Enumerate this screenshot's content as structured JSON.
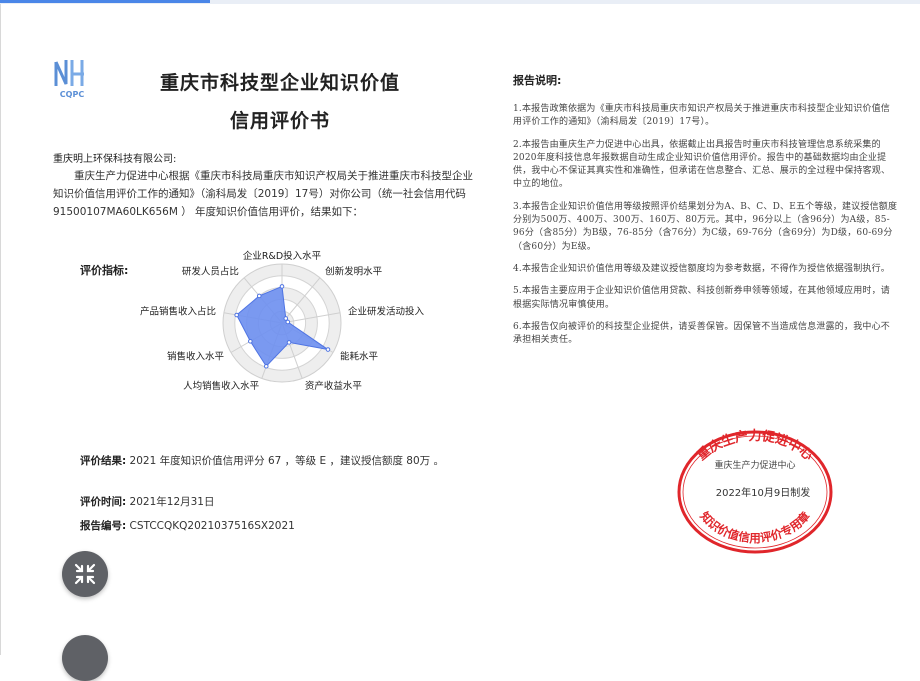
{
  "document": {
    "logo_text": "CQPC",
    "title_line1": "重庆市科技型企业知识价值",
    "title_line2": "信用评价书",
    "company": "重庆明上环保科技有限公司:",
    "intro": "重庆生产力促进中心根据《重庆市科技局重庆市知识产权局关于推进重庆市科技型企业知识价值信用评价工作的通知》（渝科局发〔2019〕17号）对你公司（统一社会信用代码 91500107MA60LK656M ） 年度知识价值信用评价，结果如下：",
    "indicators_label": "评价指标:",
    "radar": {
      "axes": [
        "企业R&D投入水平",
        "创新发明水平",
        "企业研发活动投入",
        "能耗水平",
        "资产收益水平",
        "人均销售收入水平",
        "销售收入水平",
        "产品销售收入占比",
        "研发人员占比"
      ],
      "values": [
        0.62,
        0.1,
        0.1,
        0.9,
        0.35,
        0.78,
        0.62,
        0.78,
        0.6
      ],
      "fill_color": "#6d8ff0",
      "stroke_color": "#4f74e3"
    },
    "result_label": "评价结果:",
    "result_text": "2021 年度知识价值信用评分 67 ，等级 E ，建议授信额度 80万 。",
    "time_label": "评价时间:",
    "time_value": "2021年12月31日",
    "code_label": "报告编号:",
    "code_value": "CSTCCQKQ2021037516SX2021"
  },
  "notes": {
    "title": "报告说明:",
    "items": [
      "1.本报告政策依据为《重庆市科技局重庆市知识产权局关于推进重庆市科技型企业知识价值信用评价工作的通知》（渝科局发〔2019〕17号）。",
      "2.本报告由重庆生产力促进中心出具，依据截止出具报告时重庆市科技管理信息系统采集的2020年度科技信息年报数据自动生成企业知识价值信用评价。报告中的基础数据均由企业提供，我中心不保证其真实性和准确性，但承诺在信息整合、汇总、展示的全过程中保持客观、中立的地位。",
      "3.本报告企业知识价值信用等级按照评价结果划分为A、B、C、D、E五个等级，建议授信额度分别为500万、400万、300万、160万、80万元。其中，96分以上（含96分）为A级，85-96分（含85分）为B级，76-85分（含76分）为C级，69-76分（含69分）为D级，60-69分（含60分）为E级。",
      "4.本报告企业知识价值信用等级及建议授信额度均为参考数据，不得作为授信依据强制执行。",
      "5.本报告主要应用于企业知识价值信用贷款、科技创新券申领等领域，在其他领域应用时，请根据实际情况审慎使用。",
      "6.本报告仅向被评价的科技型企业提供，请妥善保管。因保管不当造成信息泄露的，我中心不承担相关责任。"
    ]
  },
  "stamp": {
    "top_text": "重庆生产力促进中心",
    "inner_text": "重庆生产力促进中心",
    "date": "2022年10月9日制发",
    "bottom_text": "知识价值信用评价专用章",
    "color": "#e0262b"
  },
  "controls": {
    "collapse_icon": "collapse-arrows-icon",
    "fab_color": "#5f6166"
  }
}
